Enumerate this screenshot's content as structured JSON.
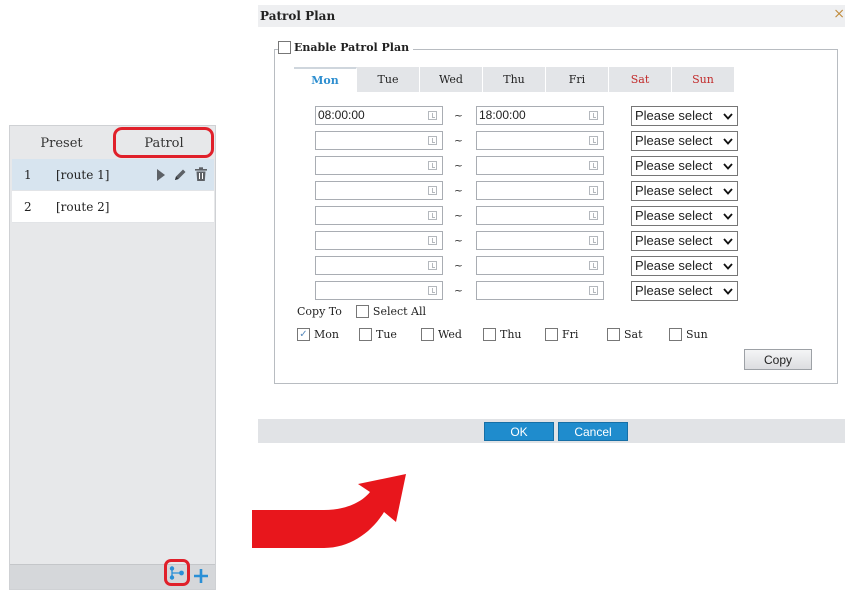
{
  "left_panel": {
    "tabs": [
      {
        "label": "Preset"
      },
      {
        "label": "Patrol"
      }
    ],
    "routes": [
      {
        "index": "1",
        "name": "[route 1]",
        "selected": true
      },
      {
        "index": "2",
        "name": "[route 2]",
        "selected": false
      }
    ],
    "icons": {
      "play": "play-icon",
      "edit": "pencil-icon",
      "delete": "trash-icon",
      "route": "patrol-route-icon",
      "add": "plus-icon"
    }
  },
  "dialog": {
    "title": "Patrol Plan",
    "close_glyph": "×",
    "enable_label": "Enable Patrol Plan",
    "enabled": false,
    "days": [
      {
        "label": "Mon",
        "active": true,
        "weekend": false
      },
      {
        "label": "Tue",
        "active": false,
        "weekend": false
      },
      {
        "label": "Wed",
        "active": false,
        "weekend": false
      },
      {
        "label": "Thu",
        "active": false,
        "weekend": false
      },
      {
        "label": "Fri",
        "active": false,
        "weekend": false
      },
      {
        "label": "Sat",
        "active": false,
        "weekend": true
      },
      {
        "label": "Sun",
        "active": false,
        "weekend": true
      }
    ],
    "time_rows": [
      {
        "start": "08:00:00",
        "end": "18:00:00",
        "route": "Please select"
      },
      {
        "start": "",
        "end": "",
        "route": "Please select"
      },
      {
        "start": "",
        "end": "",
        "route": "Please select"
      },
      {
        "start": "",
        "end": "",
        "route": "Please select"
      },
      {
        "start": "",
        "end": "",
        "route": "Please select"
      },
      {
        "start": "",
        "end": "",
        "route": "Please select"
      },
      {
        "start": "",
        "end": "",
        "route": "Please select"
      },
      {
        "start": "",
        "end": "",
        "route": "Please select"
      }
    ],
    "separator": "~",
    "copy_to_label": "Copy To",
    "select_all_label": "Select All",
    "copy_days": [
      {
        "label": "Mon",
        "checked": true
      },
      {
        "label": "Tue",
        "checked": false
      },
      {
        "label": "Wed",
        "checked": false
      },
      {
        "label": "Thu",
        "checked": false
      },
      {
        "label": "Fri",
        "checked": false
      },
      {
        "label": "Sat",
        "checked": false
      },
      {
        "label": "Sun",
        "checked": false
      }
    ],
    "copy_button": "Copy",
    "ok_button": "OK",
    "cancel_button": "Cancel"
  },
  "colors": {
    "highlight_red": "#e0202a",
    "arrow_red": "#e8161c",
    "primary_blue": "#1f8ccd",
    "active_day_blue": "#2f8fd0",
    "weekend_red": "#c22b2b",
    "selected_row": "#d7e4ef"
  }
}
